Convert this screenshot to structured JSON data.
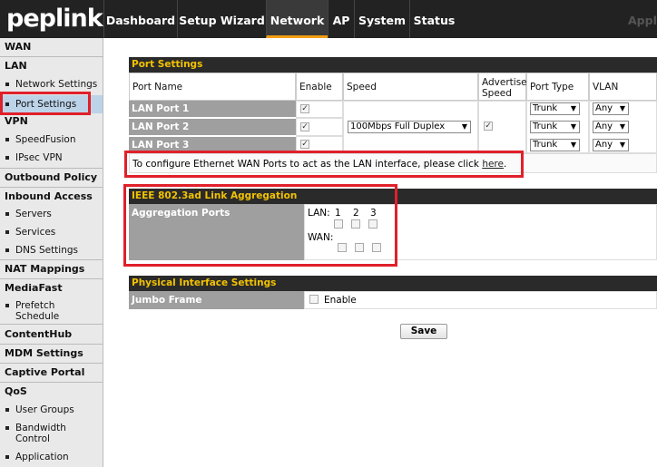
{
  "brand": {
    "logo": "peplink",
    "accent": "#f39c12"
  },
  "nav": {
    "tabs": [
      "Dashboard",
      "Setup Wizard",
      "Network",
      "AP",
      "System",
      "Status",
      "Appl"
    ],
    "active": "Network"
  },
  "sidebar": {
    "wan": "WAN",
    "lan": "LAN",
    "lan_items": [
      "Network Settings",
      "Port Settings"
    ],
    "vpn": "VPN",
    "vpn_items": [
      "SpeedFusion",
      "IPsec VPN"
    ],
    "outbound": "Outbound Policy",
    "inbound": "Inbound Access",
    "inbound_items": [
      "Servers",
      "Services",
      "DNS Settings"
    ],
    "nat": "NAT Mappings",
    "mediafast": "MediaFast",
    "mediafast_items": [
      "Prefetch Schedule"
    ],
    "contenthub": "ContentHub",
    "mdm": "MDM Settings",
    "captive": "Captive Portal",
    "qos": "QoS",
    "qos_items": [
      "User Groups",
      "Bandwidth Control",
      "Application"
    ]
  },
  "port_settings": {
    "title": "Port Settings",
    "headers": {
      "port_name": "Port Name",
      "enable": "Enable",
      "speed": "Speed",
      "advertise": "Advertise Speed",
      "port_type": "Port Type",
      "vlan": "VLAN"
    },
    "ports": [
      {
        "name": "LAN Port 1",
        "enabled": true,
        "type": "Trunk",
        "vlan": "Any"
      },
      {
        "name": "LAN Port 2",
        "enabled": true,
        "type": "Trunk",
        "vlan": "Any"
      },
      {
        "name": "LAN Port 3",
        "enabled": true,
        "type": "Trunk",
        "vlan": "Any"
      }
    ],
    "speed_value": "100Mbps Full Duplex",
    "advertise_checked": true,
    "note_prefix": "To configure Ethernet WAN Ports to act as the LAN interface, please click ",
    "note_link": "here",
    "note_suffix": "."
  },
  "link_aggregation": {
    "title": "IEEE 802.3ad Link Aggregation",
    "label": "Aggregation Ports",
    "lan_label": "LAN:",
    "wan_label": "WAN:",
    "lan_ports": [
      "1",
      "2",
      "3"
    ]
  },
  "physical": {
    "title": "Physical Interface Settings",
    "label": "Jumbo Frame",
    "enable_label": "Enable"
  },
  "save_label": "Save"
}
